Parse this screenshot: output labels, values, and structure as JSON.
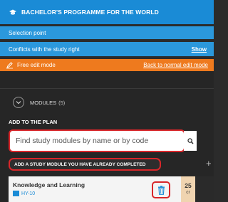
{
  "header": {
    "title": "BACHELOR'S PROGRAMME FOR THE WORLD"
  },
  "info_rows": {
    "selection_point": "Selection point",
    "conflicts": "Conflicts with the study right",
    "conflicts_link": "Show"
  },
  "edit_mode": {
    "label": "Free edit mode",
    "link": "Back to normal edit mode"
  },
  "modules": {
    "label": "MODULES",
    "count": "(5)"
  },
  "add_to_plan": {
    "heading": "ADD TO THE PLAN",
    "search_placeholder": "Find study modules by name or by code",
    "add_completed_label": "ADD A STUDY MODULE YOU HAVE ALREADY COMPLETED",
    "plus": "+"
  },
  "module_card": {
    "title": "Knowledge and Learning",
    "code": "HY-10",
    "credits": "25",
    "credit_unit": "cr"
  },
  "colors": {
    "header": "#1a8bd6",
    "info": "#2b98dc",
    "edit_mode": "#ee7a1e",
    "highlight": "#d8262a"
  }
}
